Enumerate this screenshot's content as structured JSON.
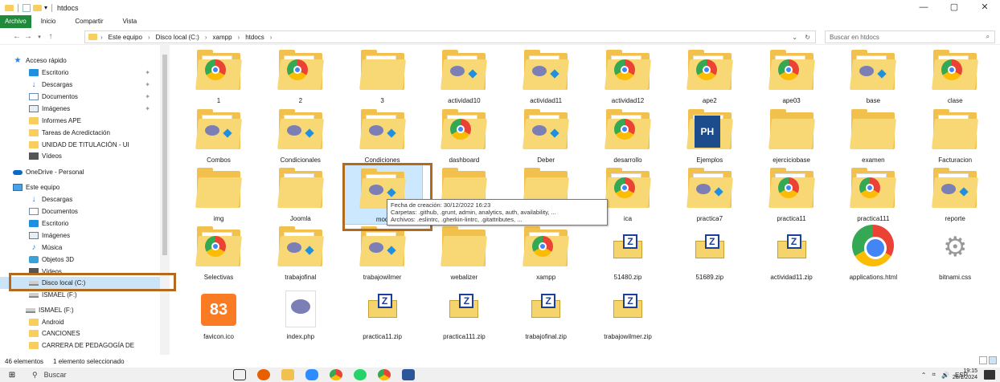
{
  "window": {
    "title": "htdocs",
    "controls": {
      "minimize": "—",
      "maximize": "▢",
      "close": "✕"
    }
  },
  "ribbon": {
    "tabs": [
      "Archivo",
      "Inicio",
      "Compartir",
      "Vista"
    ]
  },
  "address": {
    "crumbs": [
      "Este equipo",
      "Disco local (C:)",
      "xampp",
      "htdocs"
    ],
    "search_placeholder": "Buscar en htdocs"
  },
  "nav": {
    "items": [
      {
        "label": "Acceso rápido",
        "icon": "star-icon",
        "pinned": false
      },
      {
        "label": "Escritorio",
        "icon": "desktop-icon",
        "pinned": true
      },
      {
        "label": "Descargas",
        "icon": "download-icon",
        "pinned": true
      },
      {
        "label": "Documentos",
        "icon": "documents-icon",
        "pinned": true
      },
      {
        "label": "Imágenes",
        "icon": "images-icon",
        "pinned": true
      },
      {
        "label": "Informes APE",
        "icon": "folder-icon",
        "pinned": false
      },
      {
        "label": "Tareas de Acredictación",
        "icon": "folder-icon",
        "pinned": false
      },
      {
        "label": "UNIDAD DE TITULACIÓN - UI",
        "icon": "folder-icon",
        "pinned": false
      },
      {
        "label": "Vídeos",
        "icon": "videos-icon",
        "pinned": false
      },
      {
        "label": "OneDrive - Personal",
        "icon": "onedrive-icon",
        "pinned": false
      },
      {
        "label": "Este equipo",
        "icon": "pc-icon",
        "pinned": false
      },
      {
        "label": "Descargas",
        "icon": "download-icon",
        "pinned": false
      },
      {
        "label": "Documentos",
        "icon": "documents-icon",
        "pinned": false
      },
      {
        "label": "Escritorio",
        "icon": "desktop-icon",
        "pinned": false
      },
      {
        "label": "Imágenes",
        "icon": "images-icon",
        "pinned": false
      },
      {
        "label": "Música",
        "icon": "music-icon",
        "pinned": false
      },
      {
        "label": "Objetos 3D",
        "icon": "3d-objects-icon",
        "pinned": false
      },
      {
        "label": "Vídeos",
        "icon": "videos-icon",
        "pinned": false
      },
      {
        "label": "Disco local (C:)",
        "icon": "drive-icon",
        "pinned": false,
        "selected": true
      },
      {
        "label": "ISMAEL (F:)",
        "icon": "drive-icon",
        "pinned": false
      },
      {
        "label": "ISMAEL (F:)",
        "icon": "drive-icon",
        "pinned": false
      },
      {
        "label": "Android",
        "icon": "folder-icon",
        "pinned": false
      },
      {
        "label": "CANCIONES",
        "icon": "folder-icon",
        "pinned": false
      },
      {
        "label": "CARRERA DE PEDAGOGÍA DE",
        "icon": "folder-icon",
        "pinned": false
      }
    ]
  },
  "files": [
    {
      "name": "1",
      "kind": "folder-chrome"
    },
    {
      "name": "2",
      "kind": "folder-chrome"
    },
    {
      "name": "3",
      "kind": "folder-doc"
    },
    {
      "name": "actividad10",
      "kind": "folder-php"
    },
    {
      "name": "actividad11",
      "kind": "folder-php"
    },
    {
      "name": "actividad12",
      "kind": "folder-chrome"
    },
    {
      "name": "ape2",
      "kind": "folder-chrome"
    },
    {
      "name": "ape03",
      "kind": "folder-chrome"
    },
    {
      "name": "base",
      "kind": "folder-php"
    },
    {
      "name": "clase",
      "kind": "folder-chrome"
    },
    {
      "name": "Combos",
      "kind": "folder-php"
    },
    {
      "name": "Condicionales",
      "kind": "folder-php"
    },
    {
      "name": "Condiciones",
      "kind": "folder-php"
    },
    {
      "name": "dashboard",
      "kind": "folder-chrome"
    },
    {
      "name": "Deber",
      "kind": "folder-php"
    },
    {
      "name": "desarrollo",
      "kind": "folder-chrome"
    },
    {
      "name": "Ejemplos",
      "kind": "folder-ph"
    },
    {
      "name": "ejerciciobase",
      "kind": "folder"
    },
    {
      "name": "examen",
      "kind": "folder"
    },
    {
      "name": "Facturacion",
      "kind": "folder-doc"
    },
    {
      "name": "img",
      "kind": "folder"
    },
    {
      "name": "Joomla",
      "kind": "folder-doc"
    },
    {
      "name": "mod",
      "kind": "folder-php",
      "selected": true
    },
    {
      "name": "",
      "kind": "folder"
    },
    {
      "name": "",
      "kind": "folder"
    },
    {
      "name": "ica",
      "kind": "folder-chrome"
    },
    {
      "name": "practica7",
      "kind": "folder-php"
    },
    {
      "name": "practica11",
      "kind": "folder-chrome"
    },
    {
      "name": "practica111",
      "kind": "folder-chrome"
    },
    {
      "name": "reporte",
      "kind": "folder-php"
    },
    {
      "name": "Selectivas",
      "kind": "folder-chrome"
    },
    {
      "name": "trabajofinal",
      "kind": "folder-php"
    },
    {
      "name": "trabajowilmer",
      "kind": "folder-php"
    },
    {
      "name": "webalizer",
      "kind": "folder"
    },
    {
      "name": "xampp",
      "kind": "folder-chrome"
    },
    {
      "name": "51480.zip",
      "kind": "zip"
    },
    {
      "name": "51689.zip",
      "kind": "zip"
    },
    {
      "name": "actividad11.zip",
      "kind": "zip"
    },
    {
      "name": "applications.html",
      "kind": "chrome"
    },
    {
      "name": "bitnami.css",
      "kind": "gear"
    },
    {
      "name": "favicon.ico",
      "kind": "xampp"
    },
    {
      "name": "index.php",
      "kind": "php"
    },
    {
      "name": "practica11.zip",
      "kind": "zip"
    },
    {
      "name": "practica111.zip",
      "kind": "zip"
    },
    {
      "name": "trabajofinal.zip",
      "kind": "zip"
    },
    {
      "name": "trabajowilmer.zip",
      "kind": "zip"
    }
  ],
  "tooltip": {
    "line1": "Fecha de creación: 30/12/2022 16:23",
    "line2": "Carpetas: .github, .grunt, admin, analytics, auth, availability, ...",
    "line3": "Archivos: .eslintrc, .gherkin-lintrc, .gitattributes, ..."
  },
  "status": {
    "count": "46 elementos",
    "selection": "1 elemento seleccionado"
  },
  "taskbar": {
    "search": "Buscar",
    "lang": "ESP",
    "time": "19:15",
    "date": "28/1/2024"
  },
  "colors": {
    "accent": "#1e8a3a",
    "highlight": "#b46a1e",
    "selection": "#cce8ff"
  }
}
